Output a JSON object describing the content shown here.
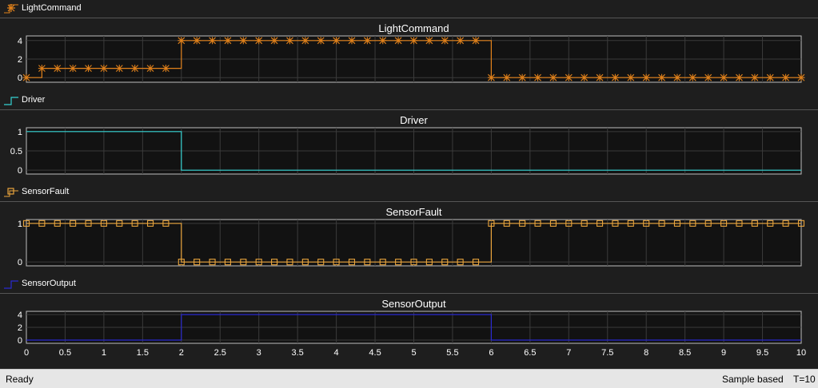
{
  "panels": [
    {
      "legend_label": "LightCommand",
      "color": "#e0811b",
      "marker": "asterisk",
      "legend_icon": "asterisk-line-icon"
    },
    {
      "legend_label": "Driver",
      "color": "#35d3d3",
      "marker": "none",
      "legend_icon": "step-line-icon"
    },
    {
      "legend_label": "SensorFault",
      "color": "#e9a43c",
      "marker": "square",
      "legend_icon": "square-line-icon"
    },
    {
      "legend_label": "SensorOutput",
      "color": "#2a2ad0",
      "marker": "none",
      "legend_icon": "step-line-icon"
    }
  ],
  "chart_data": [
    {
      "type": "line",
      "step": true,
      "title": "LightCommand",
      "x": [
        0,
        0.2,
        0.4,
        0.6,
        0.8,
        1,
        1.2,
        1.4,
        1.6,
        1.8,
        2,
        2.2,
        2.4,
        2.6,
        2.8,
        3,
        3.2,
        3.4,
        3.6,
        3.8,
        4,
        4.2,
        4.4,
        4.6,
        4.8,
        5,
        5.2,
        5.4,
        5.6,
        5.8,
        6,
        6.2,
        6.4,
        6.6,
        6.8,
        7,
        7.2,
        7.4,
        7.6,
        7.8,
        8,
        8.2,
        8.4,
        8.6,
        8.8,
        9,
        9.2,
        9.4,
        9.6,
        9.8,
        10
      ],
      "series": [
        {
          "values": [
            0,
            1,
            1,
            1,
            1,
            1,
            1,
            1,
            1,
            1,
            4,
            4,
            4,
            4,
            4,
            4,
            4,
            4,
            4,
            4,
            4,
            4,
            4,
            4,
            4,
            4,
            4,
            4,
            4,
            4,
            0,
            0,
            0,
            0,
            0,
            0,
            0,
            0,
            0,
            0,
            0,
            0,
            0,
            0,
            0,
            0,
            0,
            0,
            0,
            0,
            0
          ]
        }
      ],
      "xlim": [
        0,
        10
      ],
      "ylim": [
        -0.5,
        4.5
      ],
      "yticks": [
        "0",
        "2",
        "4"
      ],
      "grid": true
    },
    {
      "type": "line",
      "step": true,
      "title": "Driver",
      "x": [
        0,
        2,
        2,
        10
      ],
      "series": [
        {
          "values": [
            1,
            1,
            0,
            0
          ]
        }
      ],
      "xlim": [
        0,
        10
      ],
      "ylim": [
        -0.1,
        1.1
      ],
      "yticks": [
        "0",
        "0.5",
        "1"
      ],
      "grid": true
    },
    {
      "type": "line",
      "step": true,
      "title": "SensorFault",
      "x": [
        0,
        0.2,
        0.4,
        0.6,
        0.8,
        1,
        1.2,
        1.4,
        1.6,
        1.8,
        2,
        2.2,
        2.4,
        2.6,
        2.8,
        3,
        3.2,
        3.4,
        3.6,
        3.8,
        4,
        4.2,
        4.4,
        4.6,
        4.8,
        5,
        5.2,
        5.4,
        5.6,
        5.8,
        6,
        6.2,
        6.4,
        6.6,
        6.8,
        7,
        7.2,
        7.4,
        7.6,
        7.8,
        8,
        8.2,
        8.4,
        8.6,
        8.8,
        9,
        9.2,
        9.4,
        9.6,
        9.8,
        10
      ],
      "series": [
        {
          "values": [
            1,
            1,
            1,
            1,
            1,
            1,
            1,
            1,
            1,
            1,
            0,
            0,
            0,
            0,
            0,
            0,
            0,
            0,
            0,
            0,
            0,
            0,
            0,
            0,
            0,
            0,
            0,
            0,
            0,
            0,
            1,
            1,
            1,
            1,
            1,
            1,
            1,
            1,
            1,
            1,
            1,
            1,
            1,
            1,
            1,
            1,
            1,
            1,
            1,
            1,
            1
          ]
        }
      ],
      "xlim": [
        0,
        10
      ],
      "ylim": [
        -0.1,
        1.1
      ],
      "yticks": [
        "0",
        "1"
      ],
      "grid": true
    },
    {
      "type": "line",
      "step": true,
      "title": "SensorOutput",
      "x": [
        0,
        2,
        2,
        6,
        6,
        10
      ],
      "series": [
        {
          "values": [
            0,
            0,
            4,
            4,
            0,
            0
          ]
        }
      ],
      "xlim": [
        0,
        10
      ],
      "ylim": [
        -0.5,
        4.5
      ],
      "yticks": [
        "0",
        "2",
        "4"
      ],
      "grid": true,
      "xticks": [
        "0",
        "0.5",
        "1",
        "1.5",
        "2",
        "2.5",
        "3",
        "3.5",
        "4",
        "4.5",
        "5",
        "5.5",
        "6",
        "6.5",
        "7",
        "7.5",
        "8",
        "8.5",
        "9",
        "9.5",
        "10"
      ]
    }
  ],
  "status": {
    "left": "Ready",
    "mode": "Sample based",
    "time": "T=10"
  }
}
